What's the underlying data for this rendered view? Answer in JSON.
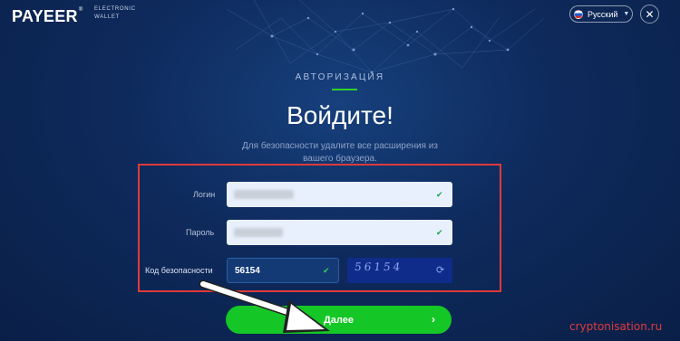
{
  "header": {
    "logo": "PAYEER",
    "logo_mark": "®",
    "tagline_line1": "ELECTRONIC",
    "tagline_line2": "WALLET",
    "language": "Русский",
    "language_icon": "russia-flag-icon",
    "close_icon": "close-icon"
  },
  "main": {
    "section_title": "АВТОРИЗАЦИЯ",
    "headline": "Войдите!",
    "security_notice": "Для безопасности удалите все расширения из вашего браузера."
  },
  "form": {
    "login_label": "Логин",
    "password_label": "Пароль",
    "security_code_label": "Код безопасности",
    "security_code_value": "56154",
    "captcha_text": "56154",
    "check_icon": "checkmark-icon",
    "refresh_icon": "refresh-icon"
  },
  "submit": {
    "label": "Далее",
    "arrow": "›"
  },
  "watermark": "cryptonisation.ru",
  "colors": {
    "background": "#0e2a5c",
    "accent_green": "#15c726",
    "highlight_red": "#e03a3a"
  }
}
